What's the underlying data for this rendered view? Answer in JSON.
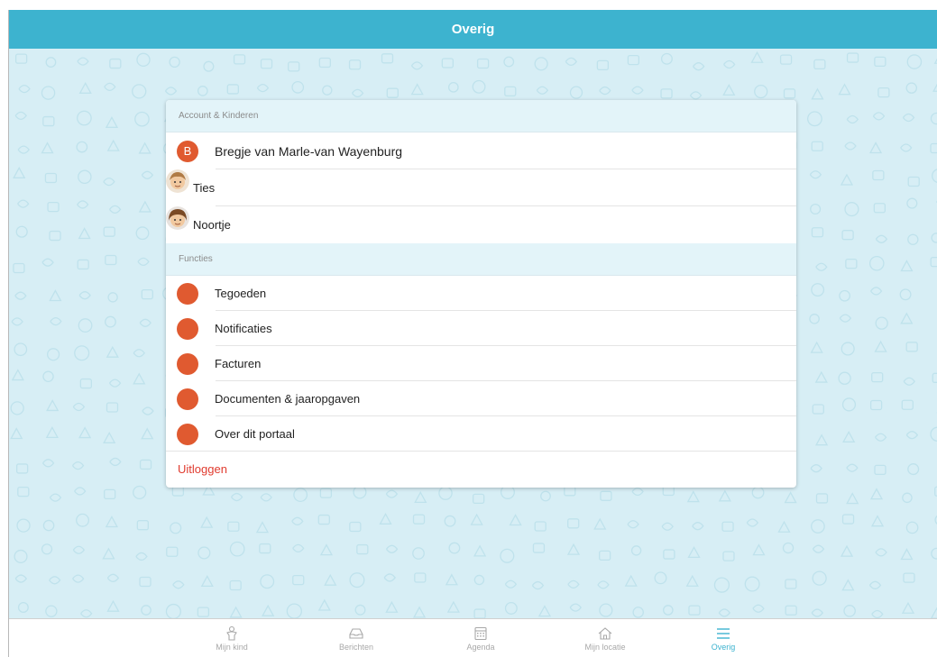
{
  "header": {
    "title": "Overig"
  },
  "sections": {
    "account": {
      "title": "Account & Kinderen",
      "parent": {
        "initial": "B",
        "name": "Bregje van Marle-van Wayenburg"
      },
      "children": [
        {
          "name": "Ties"
        },
        {
          "name": "Noortje"
        }
      ]
    },
    "functions": {
      "title": "Functies",
      "items": [
        {
          "label": "Tegoeden",
          "icon": "card-icon"
        },
        {
          "label": "Notificaties",
          "icon": "bell-icon"
        },
        {
          "label": "Facturen",
          "icon": "invoice-icon"
        },
        {
          "label": "Documenten & jaaropgaven",
          "icon": "document-icon"
        },
        {
          "label": "Over dit portaal",
          "icon": "info-icon"
        }
      ]
    }
  },
  "logout_label": "Uitloggen",
  "tabs": [
    {
      "label": "Mijn kind",
      "icon": "child-icon"
    },
    {
      "label": "Berichten",
      "icon": "inbox-icon"
    },
    {
      "label": "Agenda",
      "icon": "calendar-icon"
    },
    {
      "label": "Mijn locatie",
      "icon": "home-icon"
    },
    {
      "label": "Overig",
      "icon": "menu-icon",
      "active": true
    }
  ],
  "colors": {
    "header": "#3db3cf",
    "accent_orange": "#e05a30",
    "logout_red": "#e03b2f",
    "background": "#d7eef5"
  }
}
